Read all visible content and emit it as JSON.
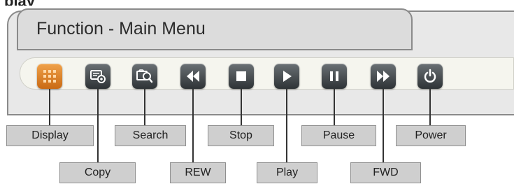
{
  "header_fragment": "play",
  "menu": {
    "title": "Function - Main Menu"
  },
  "labels": {
    "display": "Display",
    "copy": "Copy",
    "search": "Search",
    "rew": "REW",
    "stop": "Stop",
    "play": "Play",
    "pause": "Pause",
    "fwd": "FWD",
    "power": "Power"
  },
  "colors": {
    "active_button": "#e0822a",
    "button": "#3f4548",
    "label_bg": "#cfcfcf"
  },
  "icons": [
    "grid-icon",
    "copy-icon",
    "search-icon",
    "rewind-icon",
    "stop-icon",
    "play-icon",
    "pause-icon",
    "fast-forward-icon",
    "power-icon"
  ]
}
